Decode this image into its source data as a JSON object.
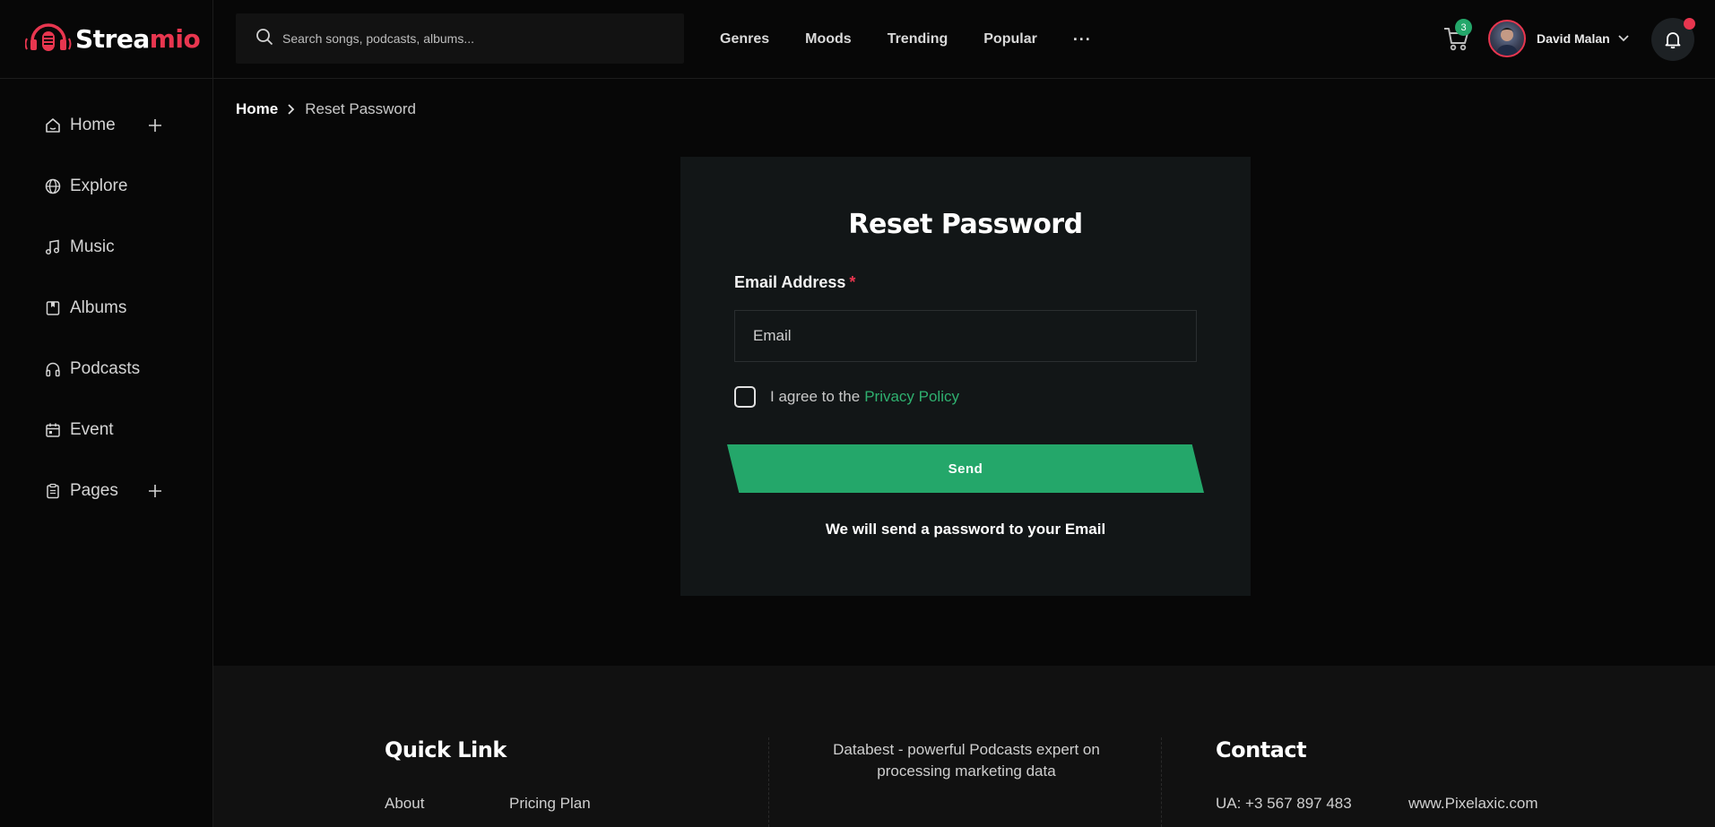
{
  "brand": {
    "name_part1": "Strea",
    "name_part2": "mio",
    "accent": "#e8364f",
    "green": "#24a76a"
  },
  "sidebar": {
    "items": [
      {
        "label": "Home",
        "icon": "home-icon",
        "expandable": true
      },
      {
        "label": "Explore",
        "icon": "globe-icon",
        "expandable": false
      },
      {
        "label": "Music",
        "icon": "music-note-icon",
        "expandable": false
      },
      {
        "label": "Albums",
        "icon": "album-icon",
        "expandable": false
      },
      {
        "label": "Podcasts",
        "icon": "headphones-icon",
        "expandable": false
      },
      {
        "label": "Event",
        "icon": "calendar-icon",
        "expandable": false
      },
      {
        "label": "Pages",
        "icon": "clipboard-icon",
        "expandable": true
      }
    ]
  },
  "header": {
    "search_placeholder": "Search songs, podcasts, albums...",
    "nav": [
      "Genres",
      "Moods",
      "Trending",
      "Popular"
    ],
    "more": "···",
    "cart_count": "3",
    "user_name": "David Malan"
  },
  "breadcrumb": {
    "home": "Home",
    "current": "Reset Password"
  },
  "form": {
    "title": "Reset Password",
    "email_label": "Email Address",
    "required_mark": "*",
    "email_placeholder": "Email",
    "agree_text": "I agree to the",
    "privacy_link": "Privacy Policy",
    "send_label": "Send",
    "note": "We will send a password to your Email"
  },
  "footer": {
    "quick_link_title": "Quick Link",
    "links": [
      "About",
      "Pricing Plan"
    ],
    "description": "Databest - powerful Podcasts expert on processing marketing data",
    "contact_title": "Contact",
    "phone": "UA: +3 567 897 483",
    "website": "www.Pixelaxic.com"
  }
}
